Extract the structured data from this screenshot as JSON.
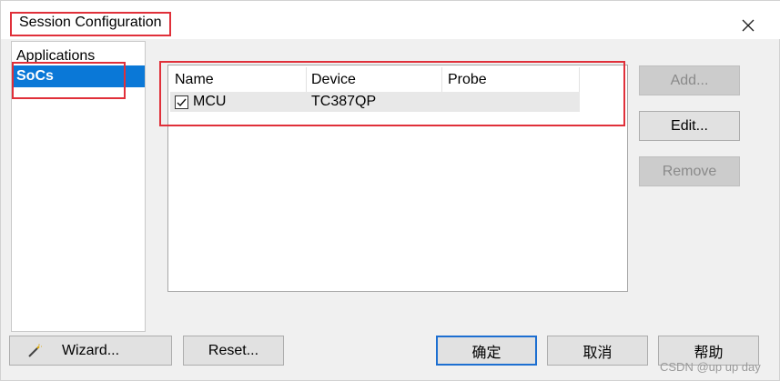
{
  "window": {
    "title": "Session Configuration"
  },
  "sidebar": {
    "items": [
      {
        "label": "Applications"
      },
      {
        "label": "SoCs"
      }
    ]
  },
  "table": {
    "columns": [
      "Name",
      "Device",
      "Probe"
    ],
    "rows": [
      {
        "checked": true,
        "name": "MCU",
        "device": "TC387QP",
        "probe": ""
      }
    ]
  },
  "side_buttons": {
    "add_label": "Add...",
    "edit_label": "Edit...",
    "remove_label": "Remove"
  },
  "footer": {
    "wizard_label": "Wizard...",
    "reset_label": "Reset...",
    "ok_label": "确定",
    "cancel_label": "取消",
    "help_label": "帮助"
  },
  "watermark": "CSDN @up up day",
  "colors": {
    "selection": "#0a78d7",
    "annotation_box": "#e0303a"
  },
  "icons": {
    "close": "close-icon",
    "check": "checkmark-icon",
    "wizard": "magic-wand-icon"
  }
}
